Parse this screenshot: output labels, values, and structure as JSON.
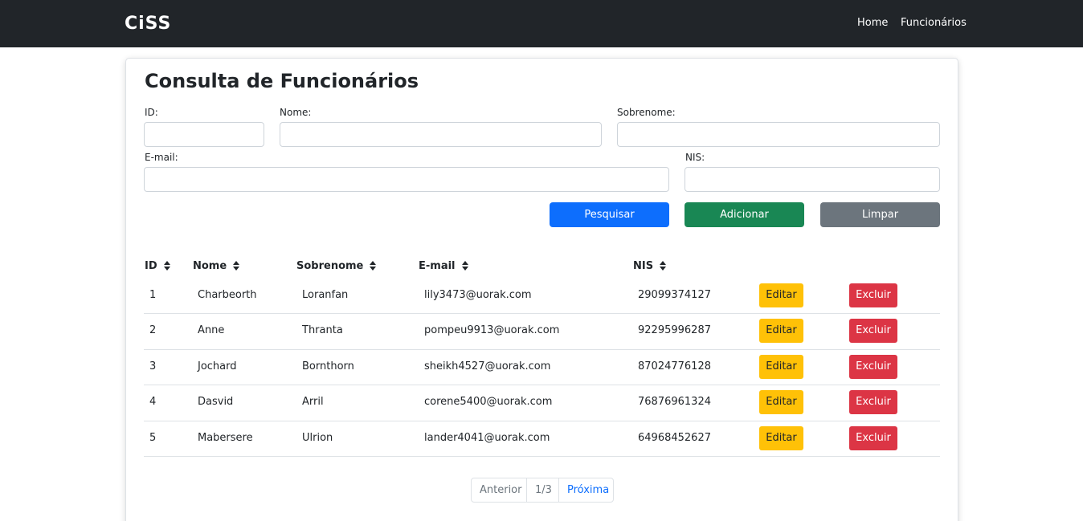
{
  "navbar": {
    "logo": "CiSS",
    "links": [
      "Home",
      "Funcionários"
    ]
  },
  "page": {
    "title": "Consulta de Funcionários"
  },
  "form": {
    "id_label": "ID:",
    "nome_label": "Nome:",
    "sobrenome_label": "Sobrenome:",
    "email_label": "E-mail:",
    "nis_label": "NIS:",
    "id_value": "",
    "nome_value": "",
    "sobrenome_value": "",
    "email_value": "",
    "nis_value": ""
  },
  "actions": {
    "search": "Pesquisar",
    "add": "Adicionar",
    "clear": "Limpar"
  },
  "table": {
    "headers": [
      "ID",
      "Nome",
      "Sobrenome",
      "E-mail",
      "NIS"
    ],
    "rows": [
      {
        "id": "1",
        "nome": "Charbeorth",
        "sobrenome": "Loranfan",
        "email": "lily3473@uorak.com",
        "nis": "29099374127"
      },
      {
        "id": "2",
        "nome": "Anne",
        "sobrenome": "Thranta",
        "email": "pompeu9913@uorak.com",
        "nis": "92295996287"
      },
      {
        "id": "3",
        "nome": "Jochard",
        "sobrenome": "Bornthorn",
        "email": "sheikh4527@uorak.com",
        "nis": "87024776128"
      },
      {
        "id": "4",
        "nome": "Dasvid",
        "sobrenome": "Arril",
        "email": "corene5400@uorak.com",
        "nis": "76876961324"
      },
      {
        "id": "5",
        "nome": "Mabersere",
        "sobrenome": "Ulrion",
        "email": "lander4041@uorak.com",
        "nis": "64968452627"
      }
    ],
    "edit_label": "Editar",
    "delete_label": "Excluir"
  },
  "pagination": {
    "prev": "Anterior",
    "current": "1/3",
    "next": "Próxima"
  },
  "colors": {
    "navbar": "#212529",
    "primary": "#0d6efd",
    "success": "#198754",
    "secondary": "#6c757d",
    "warning": "#ffc107",
    "danger": "#dc3545"
  }
}
